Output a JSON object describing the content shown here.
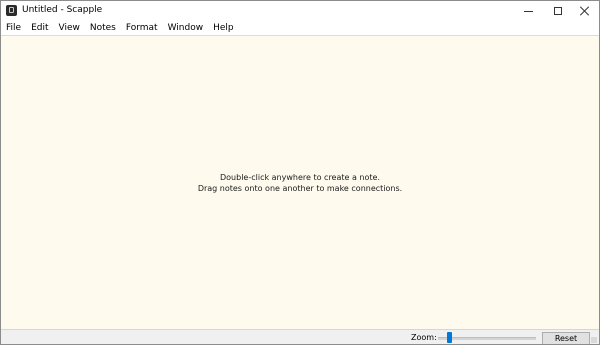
{
  "window": {
    "title": "Untitled - Scapple",
    "app_icon": "scapple-app-icon",
    "controls": {
      "minimize": "minimize-icon",
      "maximize": "maximize-icon",
      "close": "close-icon"
    }
  },
  "menubar": {
    "items": [
      {
        "label": "File"
      },
      {
        "label": "Edit"
      },
      {
        "label": "View"
      },
      {
        "label": "Notes"
      },
      {
        "label": "Format"
      },
      {
        "label": "Window"
      },
      {
        "label": "Help"
      }
    ]
  },
  "canvas": {
    "background_color": "#fefbee",
    "hint_line_1": "Double-click anywhere to create a note.",
    "hint_line_2": "Drag notes onto one another to make connections."
  },
  "statusbar": {
    "zoom_label": "Zoom:",
    "zoom_slider_level": 0.1,
    "reset_label": "Reset",
    "accent_color": "#0078d7"
  }
}
